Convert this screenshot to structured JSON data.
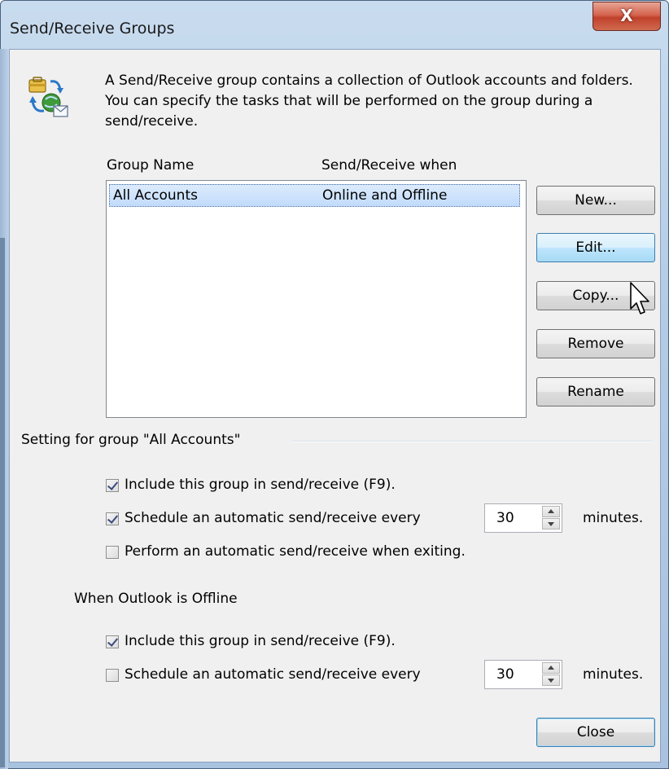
{
  "window": {
    "title": "Send/Receive Groups",
    "close_glyph": "X"
  },
  "description": "A Send/Receive group contains a collection of Outlook accounts and folders. You can specify the tasks that will be performed on the group during a send/receive.",
  "list": {
    "columns": [
      "Group Name",
      "Send/Receive when"
    ],
    "rows": [
      {
        "name": "All Accounts",
        "when": "Online and Offline",
        "selected": true
      }
    ]
  },
  "buttons": {
    "new": "New...",
    "edit": "Edit...",
    "copy": "Copy...",
    "remove": "Remove",
    "rename": "Rename",
    "close": "Close"
  },
  "settings": {
    "group_label": "Setting for group \"All Accounts\"",
    "online": {
      "include": {
        "label": "Include this group in send/receive (F9).",
        "checked": true
      },
      "schedule": {
        "label": "Schedule an automatic send/receive every",
        "checked": true,
        "value": "30",
        "unit": "minutes."
      },
      "exiting": {
        "label": "Perform an automatic send/receive when exiting.",
        "checked": false
      }
    },
    "offline_label": "When Outlook is Offline",
    "offline": {
      "include": {
        "label": "Include this group in send/receive (F9).",
        "checked": true
      },
      "schedule": {
        "label": "Schedule an automatic send/receive every",
        "checked": false,
        "value": "30",
        "unit": "minutes."
      }
    }
  },
  "icons": {
    "dialog_icon": "send-receive-groups-icon",
    "cursor": "mouse-pointer-icon"
  },
  "colors": {
    "selection": "#c1dbfc",
    "close_button": "#c1412b",
    "hover_button": "#bee6fd"
  }
}
